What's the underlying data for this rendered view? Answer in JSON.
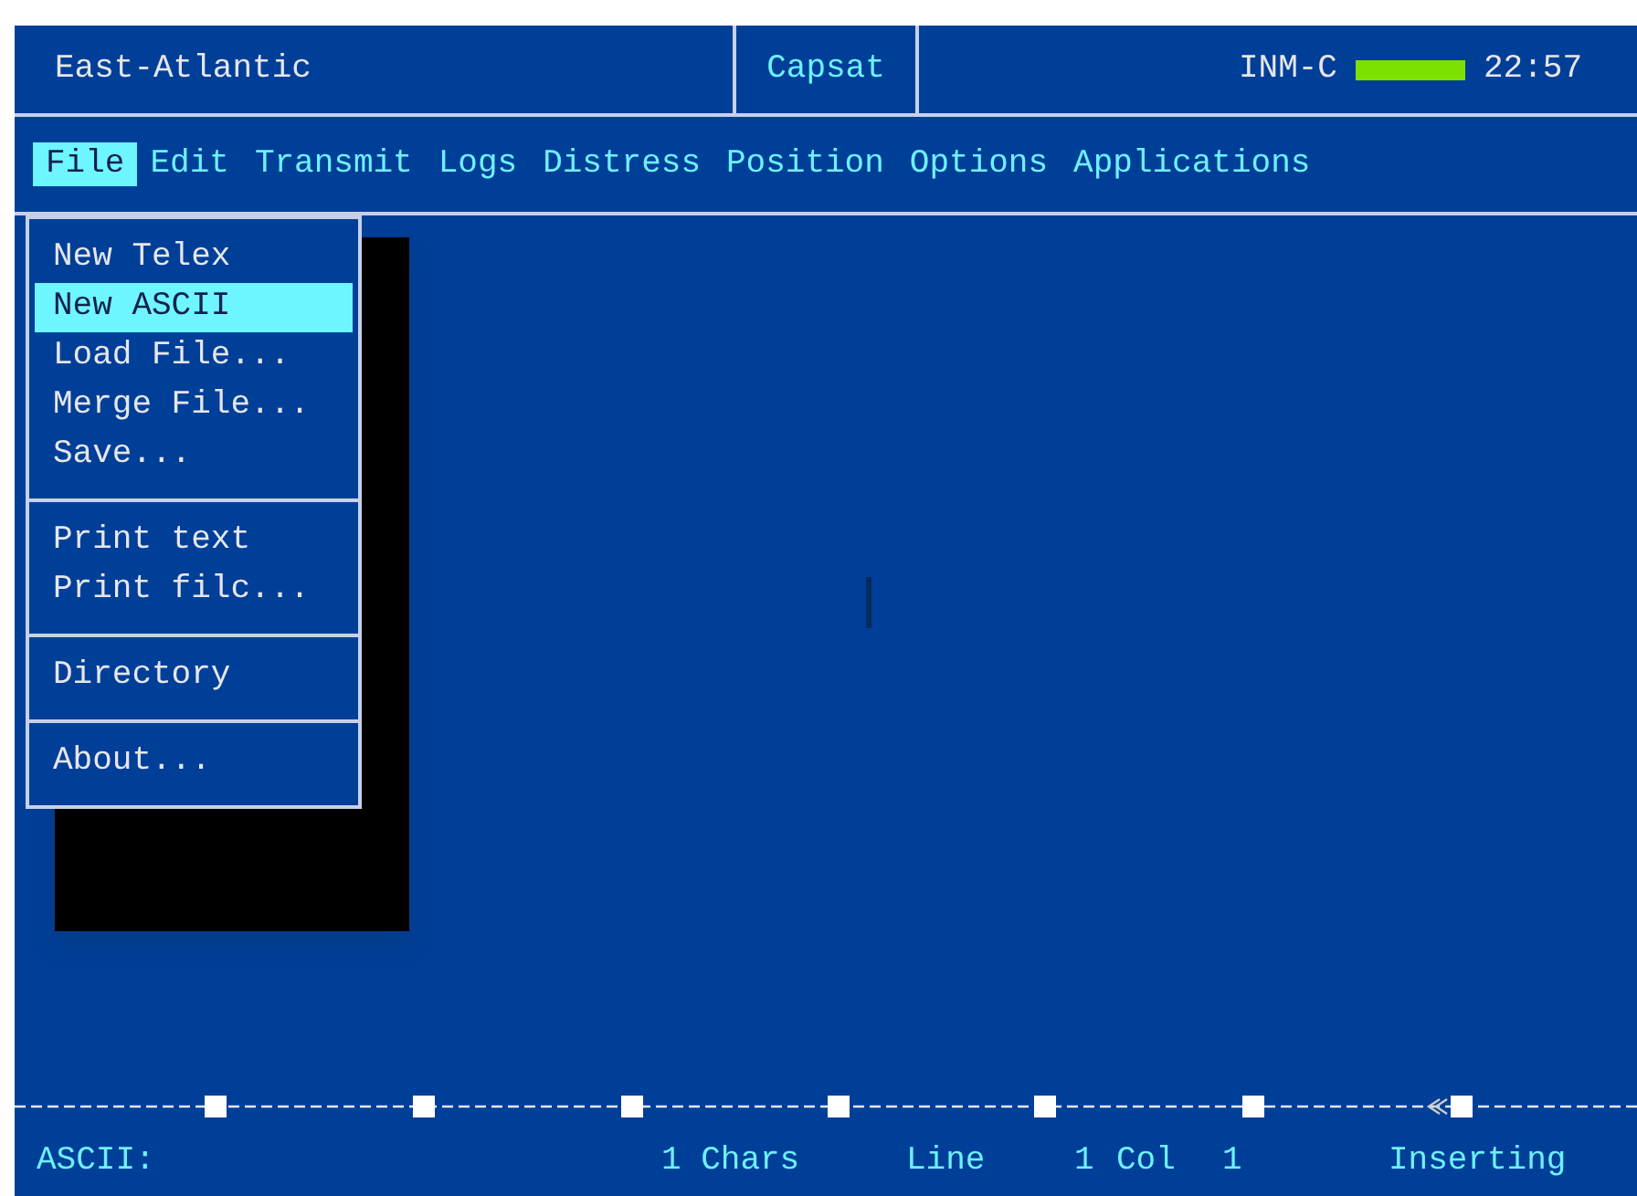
{
  "header": {
    "title": "East-Atlantic",
    "service": "Capsat",
    "network": "INM-C",
    "time": "22:57"
  },
  "menu_bar": [
    {
      "label": "File",
      "selected": true
    },
    {
      "label": "Edit",
      "selected": false
    },
    {
      "label": "Transmit",
      "selected": false
    },
    {
      "label": "Logs",
      "selected": false
    },
    {
      "label": "Distress",
      "selected": false
    },
    {
      "label": "Position",
      "selected": false
    },
    {
      "label": "Options",
      "selected": false
    },
    {
      "label": "Applications",
      "selected": false
    }
  ],
  "file_menu": [
    [
      {
        "label": "New Telex",
        "selected": false
      },
      {
        "label": "New ASCII",
        "selected": true
      },
      {
        "label": "Load File...",
        "selected": false
      },
      {
        "label": "Merge File...",
        "selected": false
      },
      {
        "label": "Save...",
        "selected": false
      }
    ],
    [
      {
        "label": "Print text",
        "selected": false
      },
      {
        "label": "Print filc...",
        "selected": false
      }
    ],
    [
      {
        "label": "Directory",
        "selected": false
      }
    ],
    [
      {
        "label": "About...",
        "selected": false
      }
    ]
  ],
  "status_bar": {
    "mode": "ASCII:",
    "chars": "1 Chars",
    "line_label": "Line",
    "line": "1",
    "col_label": "Col",
    "col": "1",
    "edit_mode": "Inserting"
  }
}
